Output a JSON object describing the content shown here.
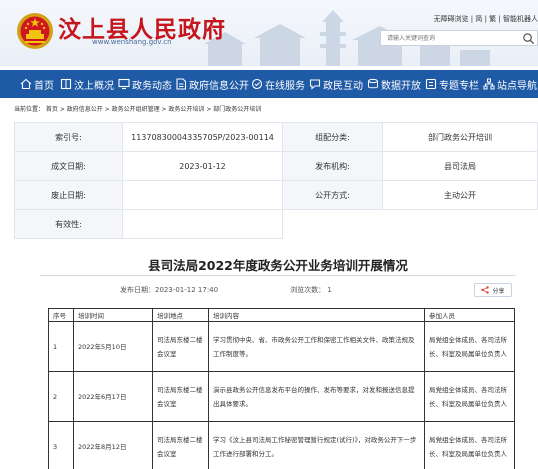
{
  "header": {
    "site_title": "汶上县人民政府",
    "site_url": "www.wenshang.gov.cn",
    "top_links": "无障碍浏览 | 简 | 繁 | 智能机器人",
    "search_placeholder": "请输入关键词查询"
  },
  "nav": {
    "items": [
      {
        "label": "首页",
        "icon": "home-icon"
      },
      {
        "label": "汶上概况",
        "icon": "book-icon"
      },
      {
        "label": "政务动态",
        "icon": "monitor-icon"
      },
      {
        "label": "政府信息公开",
        "icon": "document-icon"
      },
      {
        "label": "在线服务",
        "icon": "service-icon"
      },
      {
        "label": "政民互动",
        "icon": "chat-icon"
      },
      {
        "label": "数据开放",
        "icon": "data-icon"
      },
      {
        "label": "专题专栏",
        "icon": "column-icon"
      },
      {
        "label": "站点导航",
        "icon": "sitemap-icon"
      }
    ]
  },
  "breadcrumb": "当前位置： 首页 > 政府信息公开 > 政务公开组织管理 > 政务公开培训 > 部门政务公开培训",
  "meta": {
    "index_label": "索引号:",
    "index_value": "11370830004335705P/2023-00114",
    "category_label": "组配分类:",
    "category_value": "部门政务公开培训",
    "date_label": "成文日期:",
    "date_value": "2023-01-12",
    "issuer_label": "发布机构:",
    "issuer_value": "县司法局",
    "abolish_label": "废止日期:",
    "abolish_value": "",
    "mode_label": "公开方式:",
    "mode_value": "主动公开",
    "validity_label": "有效性:",
    "validity_value": ""
  },
  "article": {
    "title": "县司法局2022年度政务公开业务培训开展情况",
    "publish_date": "发布日期：2023-01-12 17:40",
    "views": "浏览次数： 1",
    "share_label": "分享"
  },
  "training_table": {
    "headers": [
      "序号",
      "培训时间",
      "培训地点",
      "培训内容",
      "参加人员"
    ],
    "rows": [
      {
        "no": "1",
        "time": "2022年5月10日",
        "place": "司法局东楼二楼会议室",
        "content": "学习贯彻中央、省、市政务公开工作和保密工作相关文件、政策法规及工作制度等。",
        "people": "局党组全体成员、各司法所长、科室及局属单位负责人"
      },
      {
        "no": "2",
        "time": "2022年6月17日",
        "place": "司法局东楼二楼会议室",
        "content": "演示县政务公开信息发布平台的操作、发布等要求，对发和报送信息提出具体要求。",
        "people": "局党组全体成员、各司法所长、科室及局属单位负责人"
      },
      {
        "no": "3",
        "time": "2022年8月12日",
        "place": "司法局东楼二楼会议室",
        "content": "学习《汶上县司法局工作秘密管理暂行规定(试行)》，对政务公开下一步工作进行部署和分工。",
        "people": "局党组全体成员、各司法所长、科室及局属单位负责人"
      }
    ]
  },
  "colors": {
    "title_red": "#c4161c",
    "nav_blue": "#1f5aa6",
    "label_bg": "#f4f6f9"
  }
}
